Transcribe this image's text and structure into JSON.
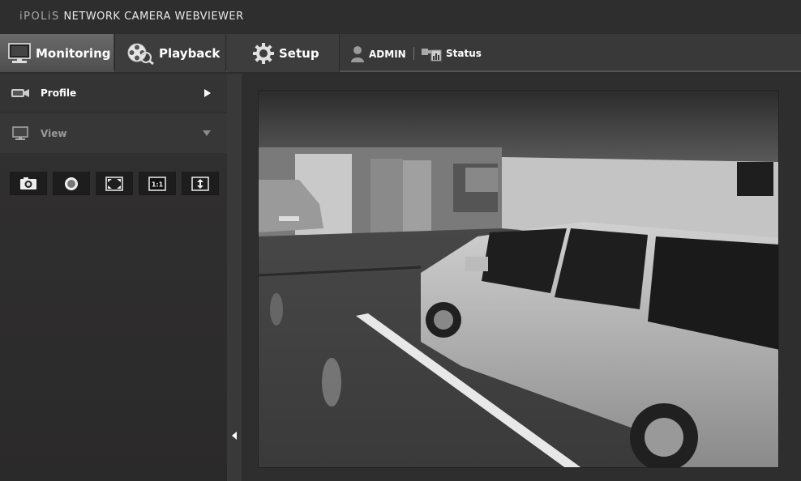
{
  "header": {
    "brand": "iPOLiS",
    "title": "NETWORK CAMERA WEBVIEWER"
  },
  "nav": {
    "tabs": [
      {
        "label": "Monitoring",
        "icon": "monitor-icon",
        "active": true
      },
      {
        "label": "Playback",
        "icon": "film-reel-icon",
        "active": false
      },
      {
        "label": "Setup",
        "icon": "gear-icon",
        "active": false
      }
    ],
    "user": {
      "label": "ADMIN",
      "icon": "user-icon"
    },
    "status": {
      "label": "Status",
      "icon": "status-icon"
    }
  },
  "sidebar": {
    "profile": {
      "label": "Profile",
      "icon": "camera-icon"
    },
    "view": {
      "label": "View",
      "icon": "monitor-icon"
    },
    "tools": [
      {
        "name": "snapshot",
        "icon": "camera-snapshot-icon"
      },
      {
        "name": "record",
        "icon": "record-icon"
      },
      {
        "name": "fullscreen",
        "icon": "fullscreen-icon"
      },
      {
        "name": "original-size",
        "icon": "one-to-one-icon",
        "text": "1:1"
      },
      {
        "name": "fit-height",
        "icon": "fit-height-icon"
      }
    ]
  },
  "colors": {
    "background": "#2e2d2d",
    "active_tab": "#5a5a5a",
    "text": "#ffffff",
    "muted_text": "#9a9a9a"
  }
}
